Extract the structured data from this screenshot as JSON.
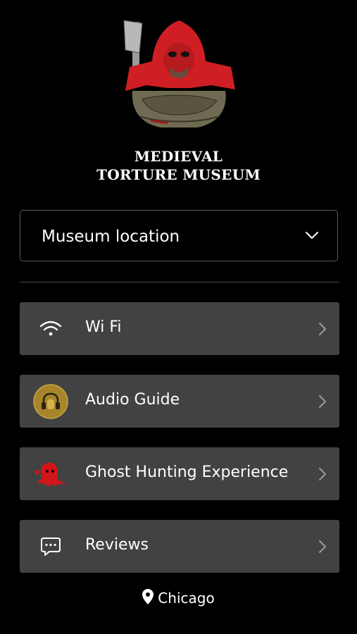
{
  "brand": {
    "line1": "MEDIEVAL",
    "line2": "TORTURE MUSEUM"
  },
  "location_select": {
    "label": "Museum location",
    "icon": "chevron-down-icon"
  },
  "menu": {
    "items": [
      {
        "label": "Wi Fi",
        "icon": "wifi-icon"
      },
      {
        "label": "Audio Guide",
        "icon": "headphones-icon"
      },
      {
        "label": "Ghost Hunting Experience",
        "icon": "ghost-icon"
      },
      {
        "label": "Reviews",
        "icon": "chat-bubble-icon"
      }
    ]
  },
  "footer": {
    "city": "Chicago",
    "icon": "map-pin-icon"
  },
  "colors": {
    "background": "#000000",
    "menu_item_bg": "#424242",
    "accent_gold": "#b08a2a",
    "accent_red": "#d0161b"
  }
}
